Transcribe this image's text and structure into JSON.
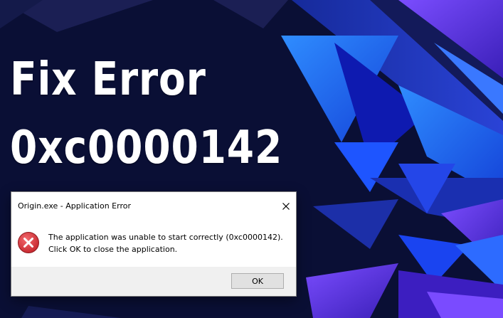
{
  "headline": {
    "line1": "Fix Error",
    "line2": "0xc0000142"
  },
  "dialog": {
    "title": "Origin.exe - Application Error",
    "message": "The application was unable to start correctly (0xc0000142). Click OK to close the application.",
    "ok_label": "OK",
    "close_icon": "close-icon",
    "status_icon": "error-icon"
  },
  "colors": {
    "background_dark": "#0a0f35",
    "accent_blue": "#1f6fff",
    "accent_purple": "#6a3df0",
    "error_red": "#d9363e",
    "dialog_white": "#ffffff",
    "dialog_footer": "#f0f0f0"
  }
}
